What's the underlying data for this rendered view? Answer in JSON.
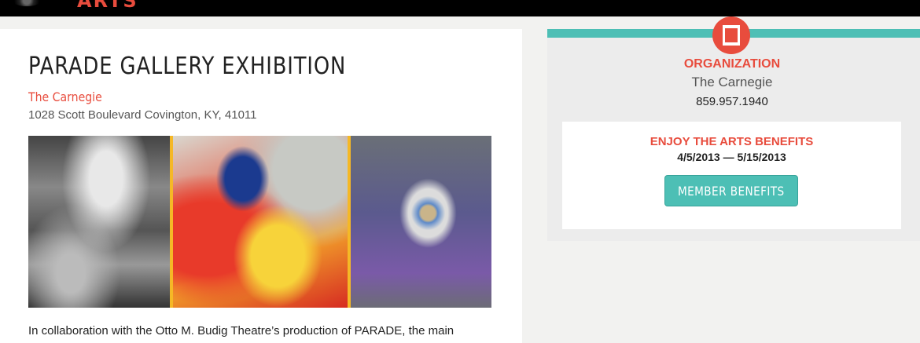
{
  "header": {
    "logo_text": "ARTS"
  },
  "event": {
    "title": "PARADE GALLERY EXHIBITION",
    "venue": "The Carnegie",
    "address": "1028 Scott Boulevard Covington, KY, 41011",
    "description": "In collaboration with the Otto M. Budig Theatre’s production of PARADE, the main"
  },
  "sidebar": {
    "org_label": "ORGANIZATION",
    "org_name": "The Carnegie",
    "org_phone": "859.957.1940",
    "benefits_title": "ENJOY THE ARTS BENEFITS",
    "benefits_dates": "4/5/2013 — 5/15/2013",
    "member_button": "MEMBER BENEFITS"
  },
  "colors": {
    "accent_red": "#e84c3d",
    "accent_teal": "#4dbfb5",
    "image_divider": "#f5b826"
  },
  "icons": {
    "organization": "organization-icon"
  }
}
